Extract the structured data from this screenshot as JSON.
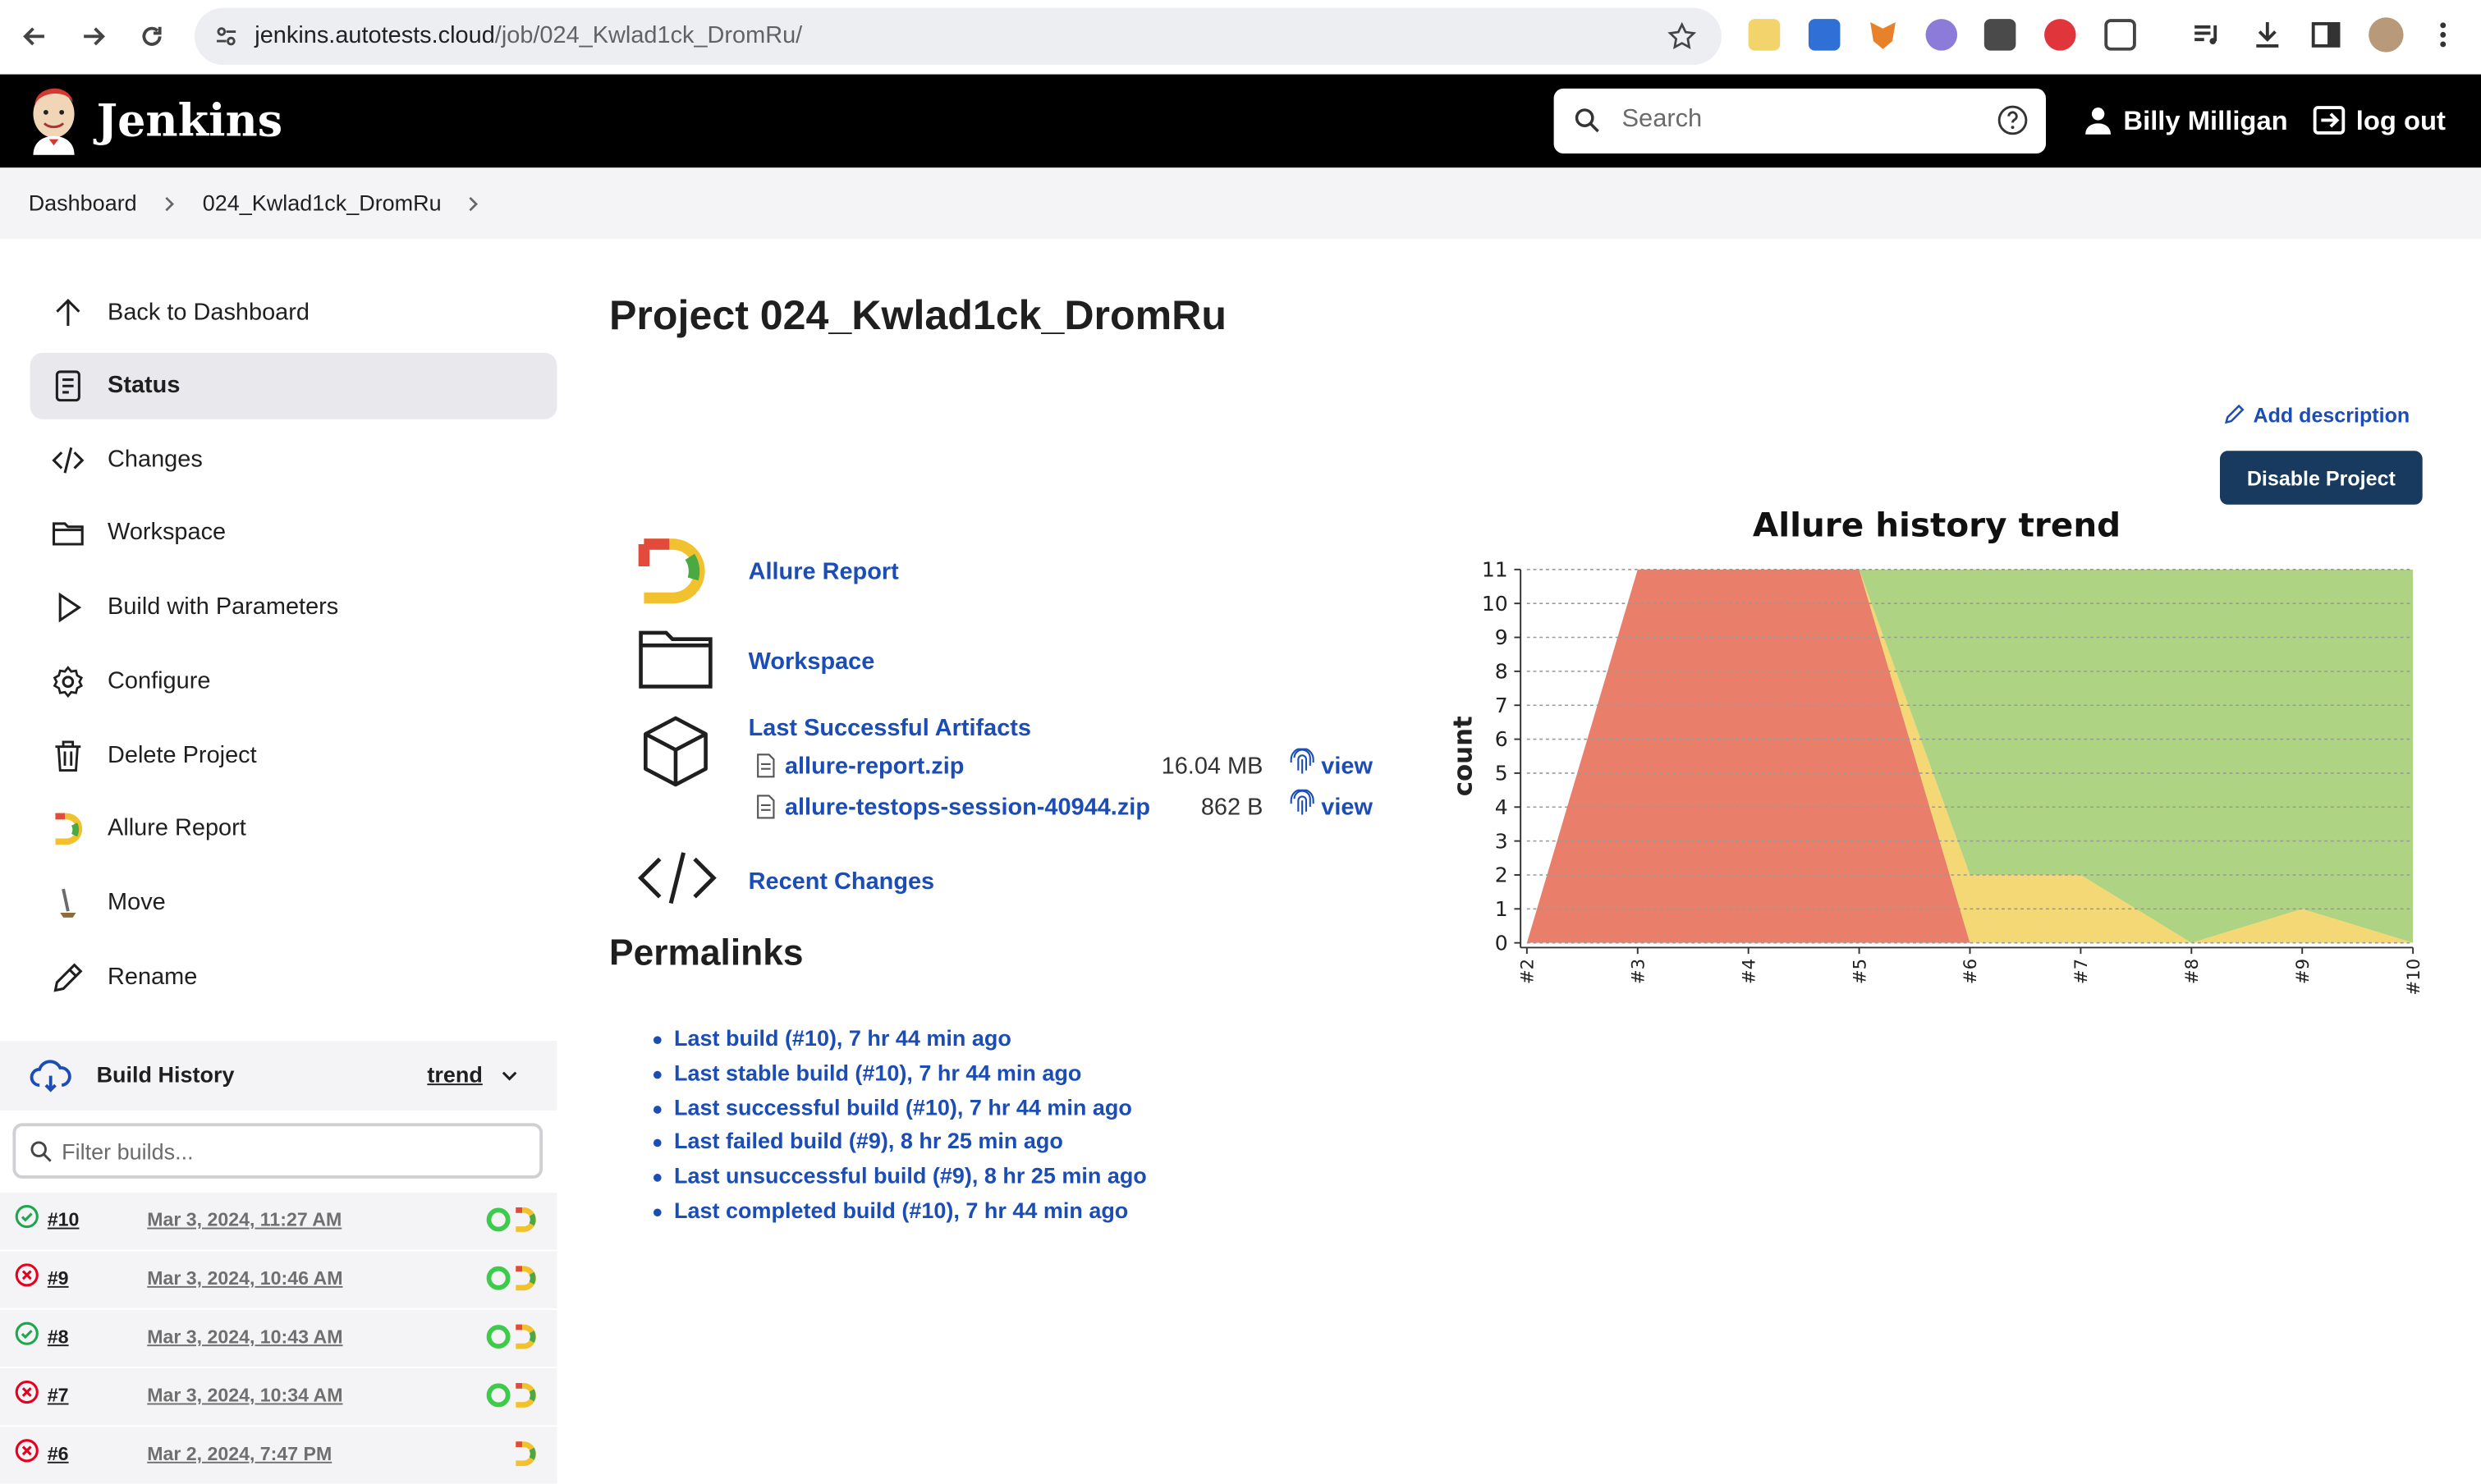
{
  "browser": {
    "url_host": "jenkins.autotests.cloud",
    "url_path": "/job/024_Kwlad1ck_DromRu/"
  },
  "header": {
    "brand": "Jenkins",
    "search_placeholder": "Search",
    "user_name": "Billy Milligan",
    "logout": "log out"
  },
  "breadcrumb": [
    "Dashboard",
    "024_Kwlad1ck_DromRu"
  ],
  "sidebar": {
    "items": [
      {
        "label": "Back to Dashboard",
        "icon": "arrow-up-icon"
      },
      {
        "label": "Status",
        "icon": "document-icon"
      },
      {
        "label": "Changes",
        "icon": "code-icon"
      },
      {
        "label": "Workspace",
        "icon": "folder-icon"
      },
      {
        "label": "Build with Parameters",
        "icon": "play-icon"
      },
      {
        "label": "Configure",
        "icon": "gear-icon"
      },
      {
        "label": "Delete Project",
        "icon": "trash-icon"
      },
      {
        "label": "Allure Report",
        "icon": "allure-icon"
      },
      {
        "label": "Move",
        "icon": "move-icon"
      },
      {
        "label": "Rename",
        "icon": "pencil-icon"
      }
    ]
  },
  "build_history": {
    "title": "Build History",
    "trend": "trend",
    "filter_placeholder": "Filter builds...",
    "builds": [
      {
        "num": "#10",
        "date": "Mar 3, 2024, 11:27 AM",
        "status": "success"
      },
      {
        "num": "#9",
        "date": "Mar 3, 2024, 10:46 AM",
        "status": "failed"
      },
      {
        "num": "#8",
        "date": "Mar 3, 2024, 10:43 AM",
        "status": "success"
      },
      {
        "num": "#7",
        "date": "Mar 3, 2024, 10:34 AM",
        "status": "failed"
      },
      {
        "num": "#6",
        "date": "Mar 2, 2024, 7:47 PM",
        "status": "failed"
      }
    ]
  },
  "main": {
    "title": "Project 024_Kwlad1ck_DromRu",
    "add_description": "Add description",
    "disable_project": "Disable Project",
    "links": {
      "allure": "Allure Report",
      "workspace": "Workspace",
      "artifacts": "Last Successful Artifacts",
      "recent_changes": "Recent Changes"
    },
    "artifacts": [
      {
        "name": "allure-report.zip",
        "size": "16.04 MB",
        "action": "view"
      },
      {
        "name": "allure-testops-session-40944.zip",
        "size": "862 B",
        "action": "view"
      }
    ],
    "permalinks_title": "Permalinks",
    "permalinks": [
      "Last build (#10), 7 hr 44 min ago",
      "Last stable build (#10), 7 hr 44 min ago",
      "Last successful build (#10), 7 hr 44 min ago",
      "Last failed build (#9), 8 hr 25 min ago",
      "Last unsuccessful build (#9), 8 hr 25 min ago",
      "Last completed build (#10), 7 hr 44 min ago"
    ]
  },
  "chart_data": {
    "type": "area",
    "title": "Allure history trend",
    "ylabel": "count",
    "xlabel": "",
    "categories": [
      "#2",
      "#3",
      "#4",
      "#5",
      "#6",
      "#7",
      "#8",
      "#9",
      "#10"
    ],
    "ylim": [
      0,
      11
    ],
    "yticks": [
      0,
      1,
      2,
      3,
      4,
      5,
      6,
      7,
      8,
      9,
      10,
      11
    ],
    "grid": true,
    "stacked": true,
    "series": [
      {
        "color": "#e97f6a",
        "values": [
          0,
          11,
          11,
          11,
          0,
          0,
          0,
          0,
          0
        ]
      },
      {
        "color": "#f5d876",
        "values": [
          0,
          0,
          0,
          0,
          2,
          2,
          0,
          1,
          0
        ]
      },
      {
        "color": "#aed383",
        "values": [
          0,
          0,
          0,
          0,
          9,
          9,
          11,
          10,
          11
        ]
      }
    ]
  }
}
